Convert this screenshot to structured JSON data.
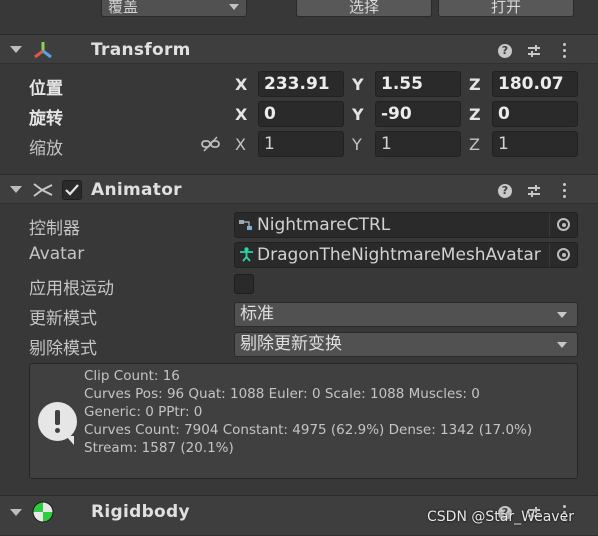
{
  "toolbar": {
    "culling_value": "覆盖",
    "select_label": "选择",
    "open_label": "打开"
  },
  "transform": {
    "title": "Transform",
    "position": {
      "label": "位置",
      "x": "233.91",
      "y": "1.55",
      "z": "180.07"
    },
    "rotation": {
      "label": "旋转",
      "x": "0",
      "y": "-90",
      "z": "0"
    },
    "scale": {
      "label": "缩放",
      "x": "1",
      "y": "1",
      "z": "1"
    },
    "axes": {
      "x": "X",
      "y": "Y",
      "z": "Z"
    }
  },
  "animator": {
    "title": "Animator",
    "enabled": true,
    "controller": {
      "label": "控制器",
      "value": "NightmareCTRL"
    },
    "avatar": {
      "label": "Avatar",
      "value": "DragonTheNightmareMeshAvatar"
    },
    "apply_root_motion": {
      "label": "应用根运动",
      "checked": false
    },
    "update_mode": {
      "label": "更新模式",
      "value": "标准"
    },
    "culling_mode": {
      "label": "剔除模式",
      "value": "剔除更新变换"
    },
    "info": [
      "Clip Count: 16",
      "Curves Pos: 96 Quat: 1088 Euler: 0 Scale: 1088 Muscles: 0",
      "Generic: 0 PPtr: 0",
      "Curves Count: 7904 Constant: 4975 (62.9%) Dense: 1342 (17.0%)",
      "Stream: 1587 (20.1%)"
    ]
  },
  "rigidbody": {
    "title": "Rigidbody"
  },
  "watermark": "CSDN @Star_Weaver",
  "colors": {
    "background": "#383838",
    "header": "#3e3e3e",
    "field": "#2a2a2a",
    "transform_icon_green": "#8fd14f",
    "transform_icon_red": "#e0574a",
    "transform_icon_blue": "#5aa0e6",
    "rigidbody_icon_green": "#2ecc40"
  }
}
